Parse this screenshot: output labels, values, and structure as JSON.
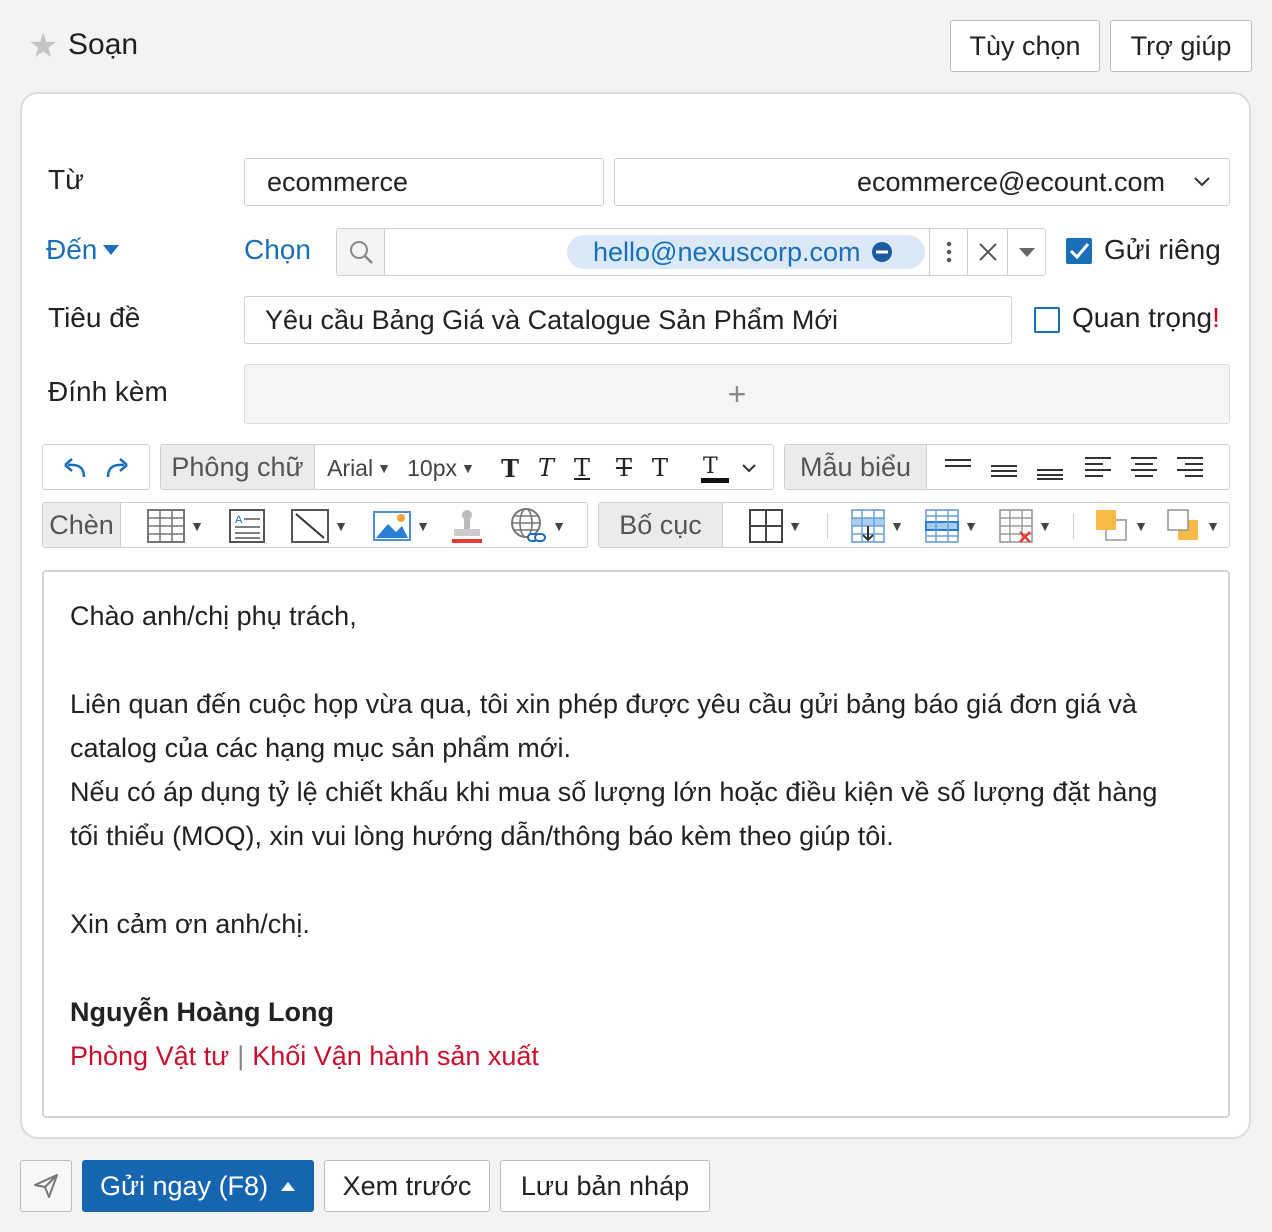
{
  "header": {
    "title": "Soạn",
    "options_label": "Tùy chọn",
    "help_label": "Trợ giúp"
  },
  "form": {
    "from_label": "Từ",
    "from_name": "ecommerce",
    "from_email": "ecommerce@ecount.com",
    "to_label": "Đến",
    "choose_label": "Chọn",
    "recipient": "hello@nexuscorp.com",
    "private_send_label": "Gửi riêng",
    "private_send_checked": true,
    "subject_label": "Tiêu đề",
    "subject_value": "Yêu cầu Bảng Giá và Catalogue Sản Phẩm Mới",
    "important_label": "Quan trọng",
    "important_mark": "!",
    "important_checked": false,
    "attach_label": "Đính kèm",
    "attach_plus": "+"
  },
  "toolbar": {
    "font_label": "Phông chữ",
    "font_family": "Arial",
    "font_size": "10px",
    "template_label": "Mẫu biểu",
    "insert_label": "Chèn",
    "layout_label": "Bố cục"
  },
  "body": {
    "greeting": "Chào anh/chị phụ trách,",
    "para1_line1": "Liên quan đến cuộc họp vừa qua, tôi xin phép được yêu cầu gửi bảng báo giá đơn giá và",
    "para1_line2": "catalog của các hạng mục sản phẩm mới.",
    "para2_line1": "Nếu có áp dụng tỷ lệ chiết khấu khi mua số lượng lớn hoặc điều kiện về số lượng đặt hàng",
    "para2_line2": "tối thiểu (MOQ), xin vui lòng hướng dẫn/thông báo kèm theo giúp tôi.",
    "closing": "Xin cảm ơn anh/chị.",
    "signature_name": "Nguyễn Hoàng Long",
    "signature_dept": "Phòng Vật tư",
    "signature_separator": "|",
    "signature_division": "Khối Vận hành sản xuất"
  },
  "footer": {
    "send_now_label": "Gửi ngay (F8)",
    "preview_label": "Xem trước",
    "save_draft_label": "Lưu bản nháp"
  },
  "colors": {
    "accent": "#1a6fb8",
    "primary_button": "#1565b0",
    "signature": "#c8102e",
    "chip": "#dbe9f6"
  },
  "icons": [
    "star-icon",
    "search-icon",
    "more-icon",
    "close-icon",
    "dropdown-icon",
    "undo-icon",
    "redo-icon",
    "send-icon"
  ]
}
